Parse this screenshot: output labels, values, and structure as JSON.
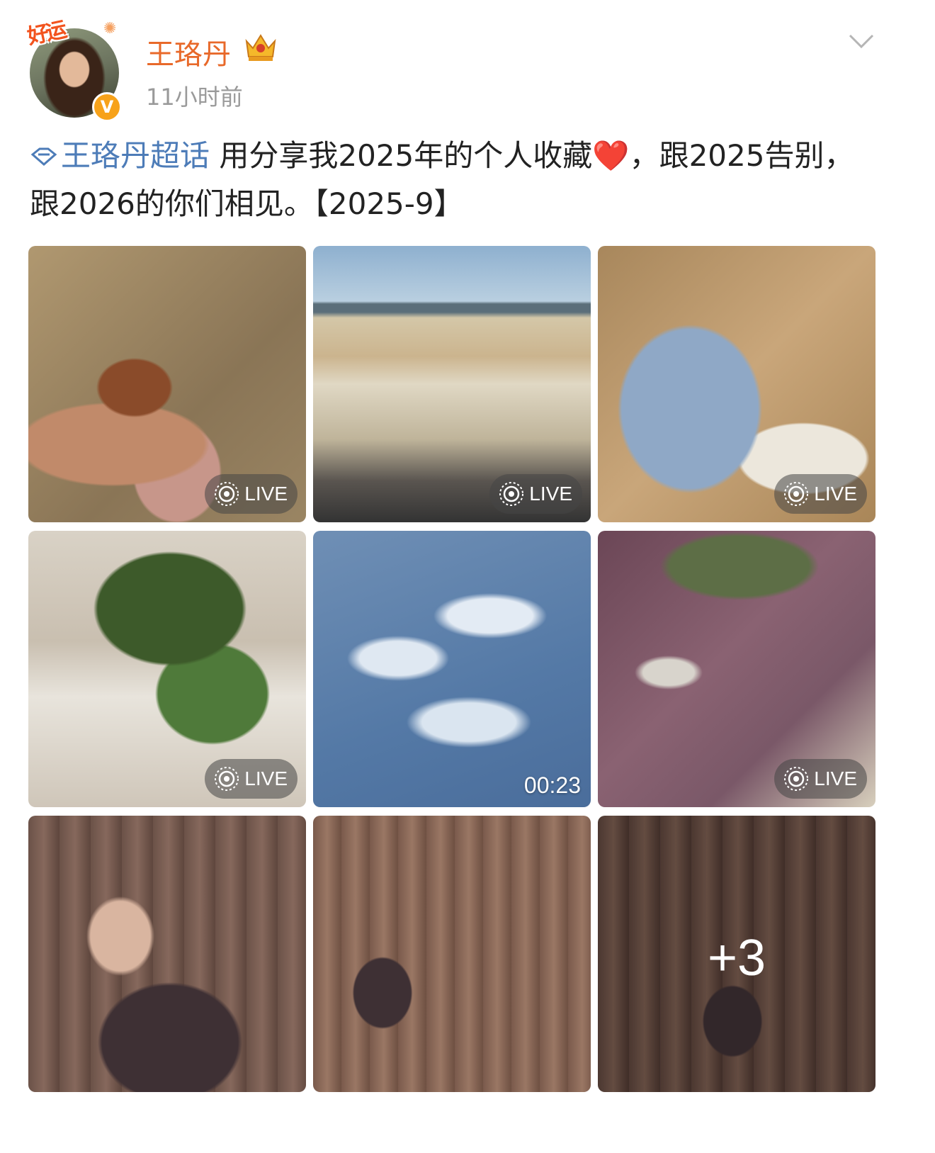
{
  "header": {
    "avatar_badge": "好运",
    "user_name": "王珞丹",
    "verified_mark": "V",
    "post_time": "11小时前"
  },
  "post": {
    "topic": "王珞丹超话",
    "text_part1": " 用分享我2025年的个人收藏",
    "heart": "❤️",
    "text_part2": "，跟2025告别，跟2026的你们相见。【2025-9】"
  },
  "media": {
    "live_label": "LIVE",
    "video_duration": "00:23",
    "more_count": "+3"
  },
  "icons": {
    "crown": "crown-icon",
    "chevron": "chevron-down-icon",
    "topic": "diamond-icon",
    "live": "live-photo-icon"
  },
  "colors": {
    "user_name": "#e8692a",
    "topic": "#4d7cb8",
    "verified": "#f7a21a"
  }
}
